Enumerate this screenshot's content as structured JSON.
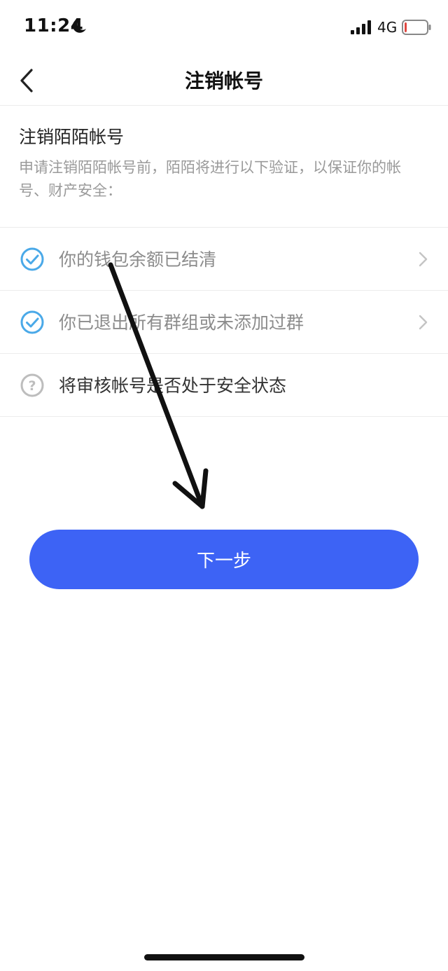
{
  "status_bar": {
    "time": "11:24",
    "network": "4G",
    "icons": [
      "moon-icon",
      "signal-icon",
      "battery-icon"
    ],
    "battery_level_fraction": 0.1
  },
  "nav": {
    "title": "注销帐号",
    "back_icon": "back-chevron-icon"
  },
  "intro": {
    "heading": "注销陌陌帐号",
    "description": "申请注销陌陌帐号前，陌陌将进行以下验证，以保证你的帐号、财产安全："
  },
  "checks": [
    {
      "label": "你的钱包余额已结清",
      "status": "passed",
      "icon": "check-circle-icon",
      "has_chevron": true
    },
    {
      "label": "你已退出所有群组或未添加过群",
      "status": "passed",
      "icon": "check-circle-icon",
      "has_chevron": true
    },
    {
      "label": "将审核帐号是否处于安全状态",
      "status": "pending",
      "icon": "question-circle-icon",
      "has_chevron": false
    }
  ],
  "actions": {
    "next_label": "下一步"
  },
  "colors": {
    "primary": "#3d63f5",
    "check": "#4aa9e8",
    "muted_text": "#9a9a9a",
    "divider": "#ececec",
    "battery_low": "#e0463f"
  }
}
